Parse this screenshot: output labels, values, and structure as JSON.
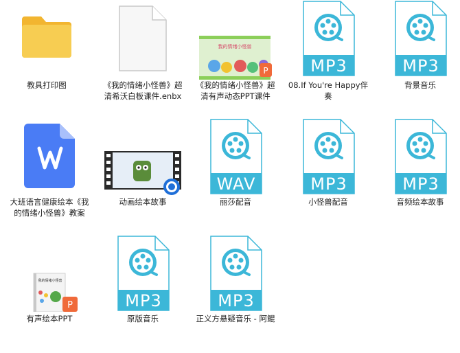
{
  "files": [
    {
      "label": "教具打印图",
      "kind": "folder"
    },
    {
      "label": "《我的情绪小怪兽》超清希沃白板课件.enbx",
      "kind": "blank"
    },
    {
      "label": "《我的情绪小怪兽》超清有声动态PPT课件",
      "kind": "ppt-thumb",
      "thumb_text": "我的情绪小怪兽"
    },
    {
      "label": "08.If You're Happy伴奏",
      "kind": "media",
      "ext": "MP3"
    },
    {
      "label": "背景音乐",
      "kind": "media",
      "ext": "MP3"
    },
    {
      "label": "大班语言健康绘本《我的情绪小怪兽》教案",
      "kind": "wps"
    },
    {
      "label": "动画绘本故事",
      "kind": "video"
    },
    {
      "label": "丽莎配音",
      "kind": "media",
      "ext": "WAV"
    },
    {
      "label": "小怪兽配音",
      "kind": "media",
      "ext": "MP3"
    },
    {
      "label": "音频绘本故事",
      "kind": "media",
      "ext": "MP3"
    },
    {
      "label": "有声绘本PPT",
      "kind": "ppt-book",
      "thumb_text": "我的情绪小怪兽"
    },
    {
      "label": "原版音乐",
      "kind": "media",
      "ext": "MP3"
    },
    {
      "label": "正义方悬疑音乐 - 阿鲲",
      "kind": "media",
      "ext": "MP3"
    }
  ],
  "colors": {
    "media_blue": "#3cb7d8",
    "folder_yellow": "#f7c542",
    "wps_blue": "#4a7cf5",
    "ppt_orange": "#f06a3a"
  }
}
